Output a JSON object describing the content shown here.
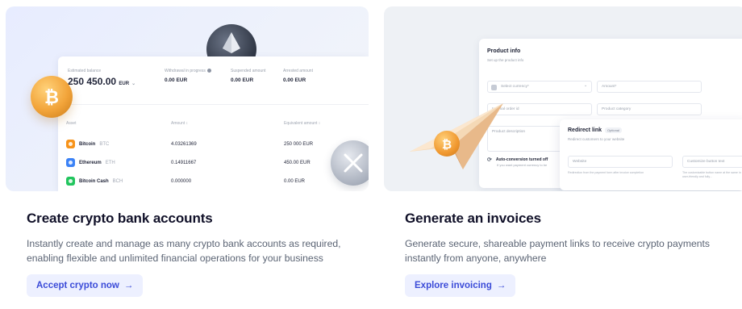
{
  "colors": {
    "accent": "#3b4bd8",
    "cta_bg": "#edf0ff",
    "bitcoin": "#f7931a",
    "ethereum": "#3b82f6",
    "bitcoin_cash": "#22c55e"
  },
  "left_card": {
    "title": "Create crypto bank accounts",
    "description": "Instantly create and manage as many crypto bank accounts as required, enabling flexible and unlimited financial operations for your business",
    "cta_label": "Accept crypto now",
    "cta_arrow": "→",
    "balance_panel": {
      "estimated_label": "Estimated balance",
      "estimated_value": "250 450.00",
      "estimated_currency": "EUR",
      "withdrawal_label": "Withdrawal in progress",
      "withdrawal_value": "0.00 EUR",
      "suspended_label": "Suspended amount",
      "suspended_value": "0.00 EUR",
      "arrested_label": "Arrested amount",
      "arrested_value": "0.00 EUR",
      "columns": [
        "Asset",
        "Amount ↕",
        "Equivalent amount ↕"
      ],
      "rows": [
        {
          "name": "Bitcoin",
          "ticker": "BTC",
          "amount": "4.03261369",
          "equivalent": "250 000 EUR",
          "icon": "bitcoin-icon"
        },
        {
          "name": "Ethereum",
          "ticker": "ETH",
          "amount": "0.14911667",
          "equivalent": "450.00 EUR",
          "icon": "ethereum-icon"
        },
        {
          "name": "Bitcoin Cash",
          "ticker": "BCH",
          "amount": "0.000000",
          "equivalent": "0.00 EUR",
          "icon": "bitcoin-cash-icon"
        }
      ]
    }
  },
  "right_card": {
    "title": "Generate an invoices",
    "description": "Generate secure, shareable payment links to receive crypto payments instantly from anyone, anywhere",
    "cta_label": "Explore invoicing",
    "cta_arrow": "→",
    "product_panel": {
      "title": "Product info",
      "subtitle": "Set up the product info",
      "currency_placeholder": "Select currency*",
      "amount_placeholder": "Amount*",
      "order_id_placeholder": "Internal order id",
      "category_placeholder": "Product category",
      "description_placeholder": "Product description",
      "conversion_label": "Auto-conversion turned off",
      "conversion_hint": "If you want payment currency to be"
    },
    "redirect_panel": {
      "title": "Redirect link",
      "badge": "Optional",
      "subtitle": "Redirect customers to your website",
      "website_placeholder": "Website",
      "website_hint": "Redirection from the payment form after invoice completion",
      "button_text_placeholder": "Customize button text",
      "button_text_hint": "The customizable button name at the same in user-friendly and fully..."
    }
  }
}
